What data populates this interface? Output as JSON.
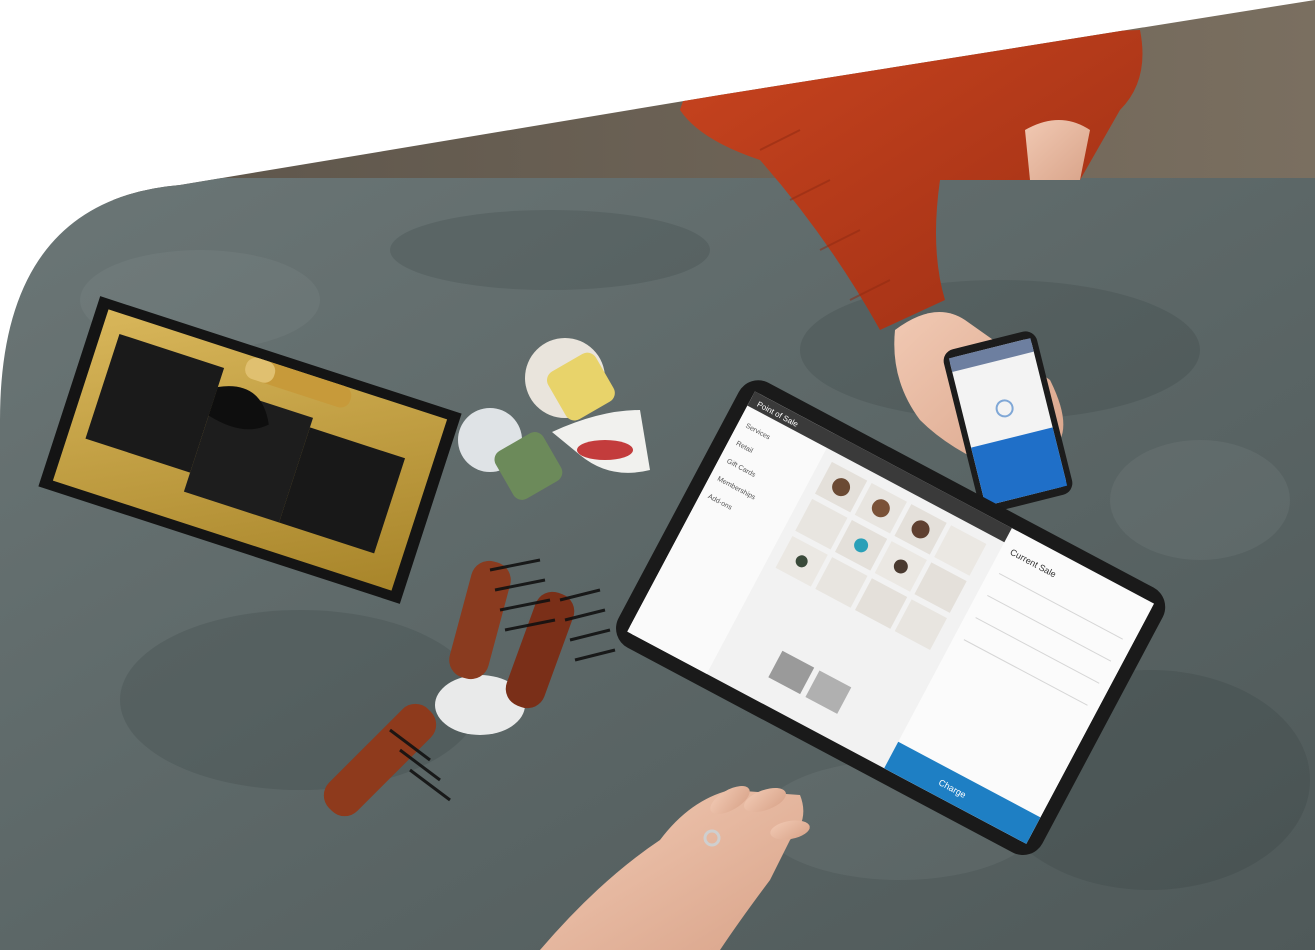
{
  "scene": {
    "description_tags": [
      "concrete-table",
      "tablet-pos",
      "smartphone",
      "hair-brushes",
      "gift-box",
      "cosmetics"
    ]
  },
  "tablet": {
    "menu_items": [
      "Services",
      "Retail",
      "Gift Cards",
      "Memberships",
      "Add-ons"
    ],
    "header_label": "Point of Sale",
    "summary_title": "Current Sale",
    "charge_label": "Charge"
  },
  "colors": {
    "table": "#5f6a6a",
    "sweater": "#b83a1c",
    "wood": "#6e5b45",
    "accent_blue": "#1e7fc4",
    "gold": "#c9a23a"
  }
}
